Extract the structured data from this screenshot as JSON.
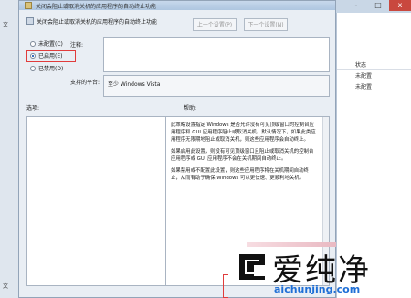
{
  "window": {
    "title": "关闭会阻止或取消关机的应用程序的自动终止功能",
    "controls": [
      "-",
      "□",
      "x"
    ]
  },
  "background": {
    "left_labels": [
      "文",
      "文"
    ],
    "right_header": "状态",
    "right_rows": [
      "未配置",
      "未配置"
    ]
  },
  "header": {
    "setting_name": "关闭会阻止或取消关机的应用程序的自动终止功能",
    "prev_button": "上一个设置(P)",
    "next_button": "下一个设置(N)"
  },
  "state_options": [
    {
      "label": "未配置(C)",
      "checked": false
    },
    {
      "label": "已启用(E)",
      "checked": true
    },
    {
      "label": "已禁用(D)",
      "checked": false
    }
  ],
  "comment_label": "注释:",
  "supported_label": "支持的平台:",
  "supported_value": "至少 Windows Vista",
  "options_label": "选项:",
  "help_label": "帮助:",
  "help_paragraphs": [
    "此策略设置指定 Windows 是否允许没有可见顶级窗口的控制台应用程序和 GUI 应用程序阻止或取消关机。默认情况下，如果此类应用程序无限期地阻止或取消关机，则这些应用程序会自动终止。",
    "如果启用此设置，则没有可见顶级窗口且阻止或取消关机的控制台应用程序或 GUI 应用程序不会在关机期间自动终止。",
    "如果禁用或不配置此设置，则这些应用程序将在关机期间自动终止，从而有助于确保 Windows 可以更快速、更顺利地关机。"
  ],
  "watermark": {
    "cn": "爱纯净",
    "url": "aichunjing.com"
  }
}
